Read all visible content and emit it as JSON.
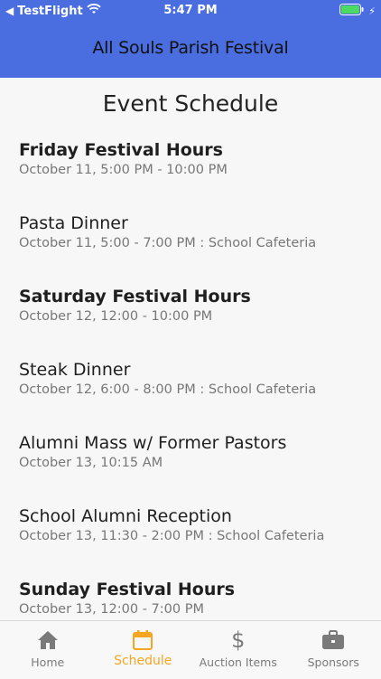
{
  "status_bar": {
    "carrier": "TestFlight",
    "time": "5:47 PM"
  },
  "nav": {
    "title": "All Souls Parish Festival"
  },
  "page": {
    "title": "Event Schedule"
  },
  "events": [
    {
      "title": "Friday Festival Hours",
      "details": "October 11, 5:00 PM - 10:00 PM",
      "bold": true
    },
    {
      "title": "Pasta Dinner",
      "details": "October 11, 5:00 - 7:00 PM : School Cafeteria",
      "bold": false
    },
    {
      "title": "Saturday Festival Hours",
      "details": "October 12, 12:00 - 10:00 PM",
      "bold": true
    },
    {
      "title": "Steak Dinner",
      "details": "October 12, 6:00 - 8:00 PM : School Cafeteria",
      "bold": false
    },
    {
      "title": "Alumni Mass w/ Former Pastors",
      "details": "October 13, 10:15 AM",
      "bold": false
    },
    {
      "title": "School Alumni Reception",
      "details": "October 13, 11:30 - 2:00 PM : School Cafeteria",
      "bold": false
    },
    {
      "title": "Sunday Festival Hours",
      "details": "October 13, 12:00 - 7:00 PM",
      "bold": true
    }
  ],
  "tabs": [
    {
      "label": "Home",
      "icon": "home-icon",
      "active": false
    },
    {
      "label": "Schedule",
      "icon": "calendar-icon",
      "active": true
    },
    {
      "label": "Auction Items",
      "icon": "dollar-icon",
      "active": false
    },
    {
      "label": "Sponsors",
      "icon": "briefcase-icon",
      "active": false
    }
  ],
  "colors": {
    "header": "#4a6ee0",
    "active_tab": "#f4a623",
    "inactive_tab": "#7a7a7a",
    "battery": "#4cd964"
  }
}
